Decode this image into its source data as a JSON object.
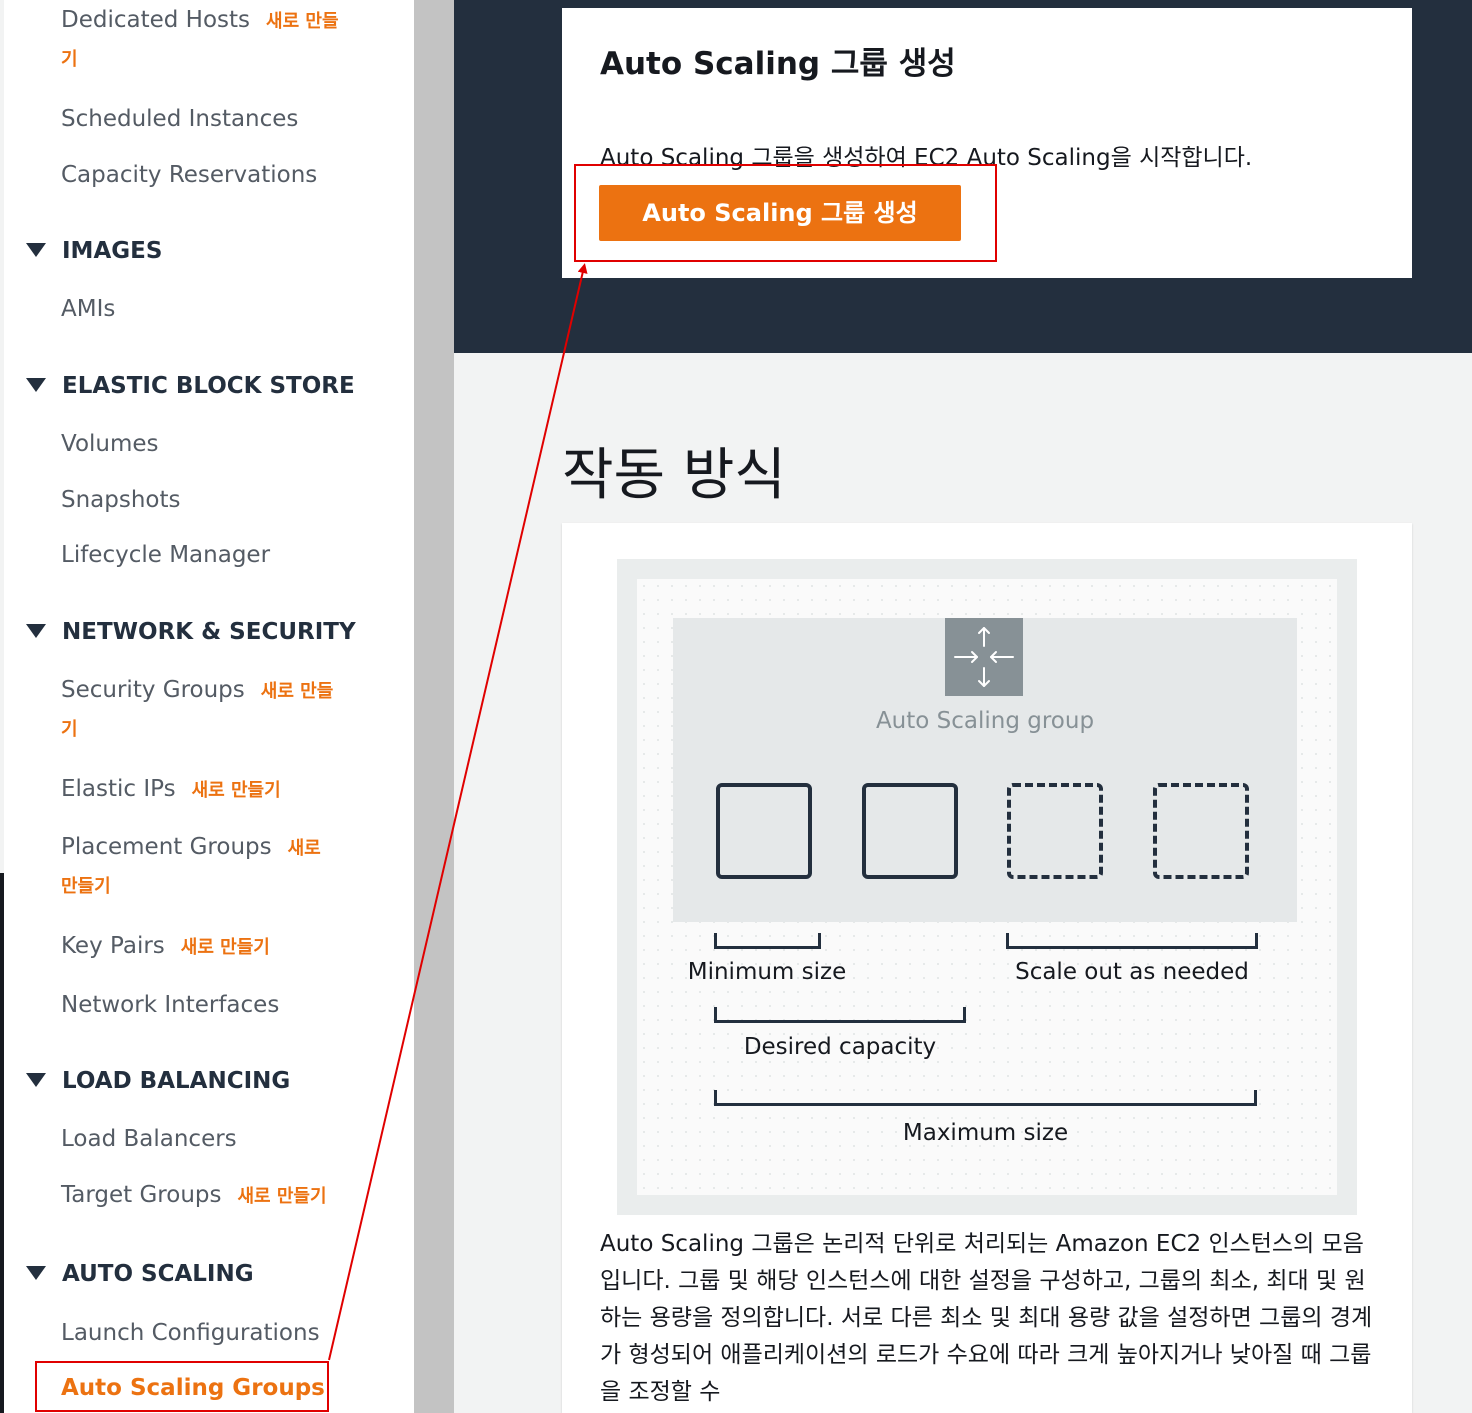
{
  "sidebar": {
    "dedicated_hosts": "Dedicated Hosts",
    "dedicated_hosts_new_a": "새로 만들",
    "dedicated_hosts_new_b": "기",
    "scheduled_instances": "Scheduled Instances",
    "capacity_reservations": "Capacity Reservations",
    "section_images": "IMAGES",
    "amis": "AMIs",
    "section_ebs": "ELASTIC BLOCK STORE",
    "volumes": "Volumes",
    "snapshots": "Snapshots",
    "lifecycle_manager": "Lifecycle Manager",
    "section_network": "NETWORK & SECURITY",
    "security_groups": "Security Groups",
    "security_groups_new_a": "새로 만들",
    "security_groups_new_b": "기",
    "elastic_ips": "Elastic IPs",
    "elastic_ips_new": "새로 만들기",
    "placement_groups": "Placement Groups",
    "placement_groups_new_a": "새로",
    "placement_groups_new_b": "만들기",
    "key_pairs": "Key Pairs",
    "key_pairs_new": "새로 만들기",
    "network_interfaces": "Network Interfaces",
    "section_lb": "LOAD BALANCING",
    "load_balancers": "Load Balancers",
    "target_groups": "Target Groups",
    "target_groups_new": "새로 만들기",
    "section_as": "AUTO SCALING",
    "launch_configurations": "Launch Configurations",
    "auto_scaling_groups": "Auto Scaling Groups"
  },
  "create": {
    "title": "Auto Scaling 그룹 생성",
    "description": "Auto Scaling 그룹을 생성하여 EC2 Auto Scaling을 시작합니다.",
    "button_label": "Auto Scaling 그룹 생성"
  },
  "how_it_works": {
    "title": "작동 방식",
    "diagram": {
      "group_label": "Auto Scaling group",
      "minimum_size": "Minimum size",
      "scale_out": "Scale out as needed",
      "desired_capacity": "Desired capacity",
      "maximum_size": "Maximum size"
    },
    "body": "Auto Scaling 그룹은 논리적 단위로 처리되는 Amazon EC2 인스턴스의 모음입니다. 그룹 및 해당 인스턴스에 대한 설정을 구성하고, 그룹의 최소, 최대 및 원하는 용량을 정의합니다. 서로 다른 최소 및 최대 용량 값을 설정하면 그룹의 경계가 형성되어 애플리케이션의 로드가 수요에 따라 크게 높아지거나 낮아질 때 그룹을 조정할 수"
  },
  "colors": {
    "accent": "#ec7211",
    "hero_bg": "#232f3e",
    "annotation": "#e00000"
  }
}
